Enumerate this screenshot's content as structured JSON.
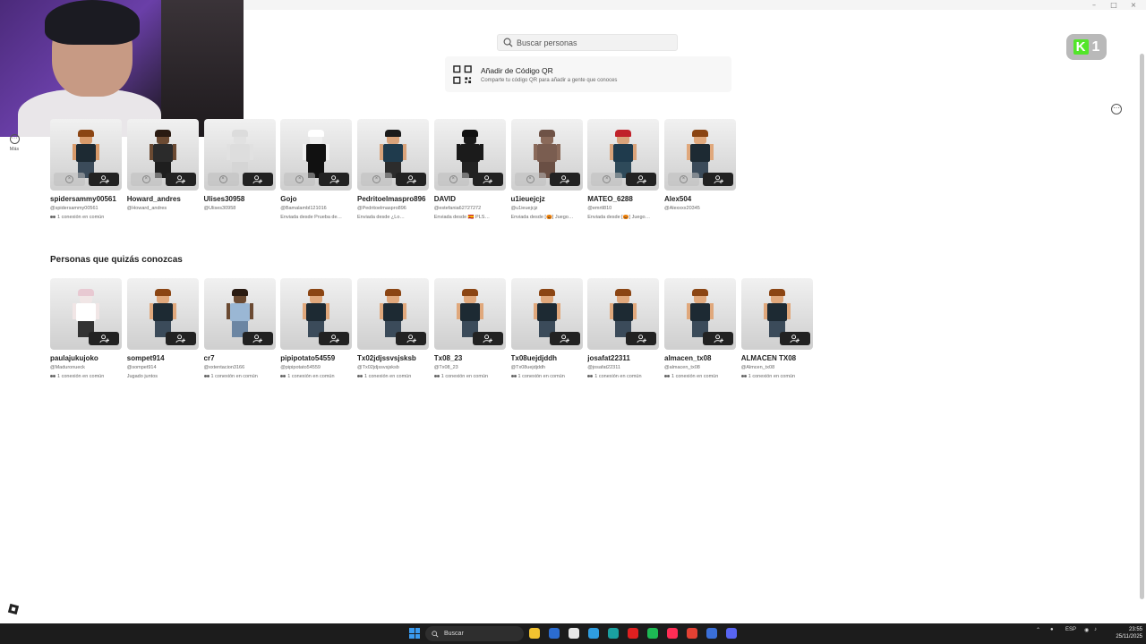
{
  "search": {
    "placeholder": "Buscar personas"
  },
  "qr": {
    "title": "Añadir de Código QR",
    "subtitle": "Comparte tu código QR para añadir a gente que conoces"
  },
  "brand_badge": {
    "letter": "K",
    "count": "1"
  },
  "left_nav": {
    "more_label": "Más"
  },
  "sections": {
    "requests": [
      {
        "name": "spidersammy00561",
        "handle": "@spidersammy00561",
        "meta": "1 conexión en común",
        "meta_icon": "people-icon",
        "skin": "#d89a6a",
        "hair": "#8b4513",
        "torso": "#1d2a33",
        "legs": "#3b4b5a"
      },
      {
        "name": "Howard_andres",
        "handle": "@Howard_andres",
        "meta": "",
        "meta_icon": "",
        "skin": "#6b4a32",
        "hair": "#2a1b12",
        "torso": "#2b2b2b",
        "legs": "#1e1e1e"
      },
      {
        "name": "Ulises30958",
        "handle": "@Ulises30958",
        "meta": "",
        "meta_icon": "",
        "skin": "#e1e1e1",
        "hair": "#dcdcdc",
        "torso": "#dddddd",
        "legs": "#d5d5d5"
      },
      {
        "name": "Gojo",
        "handle": "@Bamalambl121016",
        "meta": "Enviada desde Prueba de…",
        "meta_icon": "",
        "skin": "#f0f0f0",
        "hair": "#ffffff",
        "torso": "#111111",
        "legs": "#111111"
      },
      {
        "name": "Pedritoelmaspro896",
        "handle": "@Pedritoelmaspro896",
        "meta": "Enviada desde ¿Lo…",
        "meta_icon": "",
        "skin": "#d9a37a",
        "hair": "#1b1b1b",
        "torso": "#1f3b4d",
        "legs": "#2c2c2c"
      },
      {
        "name": "DAVID",
        "handle": "@estefania62727272",
        "meta": "Enviada desde 🇪🇸 PLS…",
        "meta_icon": "",
        "skin": "#1a1a1a",
        "hair": "#111111",
        "torso": "#1b1b1b",
        "legs": "#222222"
      },
      {
        "name": "u1ieuejcjz",
        "handle": "@u1ieuejcjz",
        "meta": "Enviada desde [🎃] Juego…",
        "meta_icon": "",
        "skin": "#8a6a5a",
        "hair": "#6e5246",
        "torso": "#7a5d50",
        "legs": "#6a4f44"
      },
      {
        "name": "MATEO_6288",
        "handle": "@emrtl810",
        "meta": "Enviada desde [🎃] Juego…",
        "meta_icon": "",
        "skin": "#d9a37a",
        "hair": "#c0222a",
        "torso": "#1f3b4d",
        "legs": "#2e4a5a"
      },
      {
        "name": "Alex504",
        "handle": "@Alexxxx20345",
        "meta": "",
        "meta_icon": "",
        "skin": "#e0a87c",
        "hair": "#8b4513",
        "torso": "#1d2a33",
        "legs": "#3b4b5a"
      }
    ],
    "suggestions_title": "Personas que quizás conozcas",
    "suggestions": [
      {
        "name": "paulajukujoko",
        "handle": "@Maduronueck",
        "meta": "1 conexión en común",
        "meta_icon": "people-icon",
        "skin": "#f1e6e6",
        "hair": "#e8c9d2",
        "torso": "#ffffff",
        "legs": "#333333"
      },
      {
        "name": "sompet914",
        "handle": "@sompet914",
        "meta": "Jugado juntos",
        "meta_icon": "",
        "skin": "#e0a87c",
        "hair": "#8b4513",
        "torso": "#1d2a33",
        "legs": "#3b4b5a"
      },
      {
        "name": "cr7",
        "handle": "@xxtentacion3166",
        "meta": "1 conexión en común",
        "meta_icon": "people-icon",
        "skin": "#6b4a32",
        "hair": "#2a1b12",
        "torso": "#9ab7d4",
        "legs": "#6c86a3"
      },
      {
        "name": "pipipotato54559",
        "handle": "@pipipotato54559",
        "meta": "1 conexión en común",
        "meta_icon": "people-icon",
        "skin": "#e0a87c",
        "hair": "#8b4513",
        "torso": "#1d2a33",
        "legs": "#3b4b5a"
      },
      {
        "name": "Tx02jdjssvsjsksb",
        "handle": "@Tx02jdjssvsjsksb",
        "meta": "1 conexión en común",
        "meta_icon": "people-icon",
        "skin": "#e0a87c",
        "hair": "#8b4513",
        "torso": "#1d2a33",
        "legs": "#3b4b5a"
      },
      {
        "name": "Tx08_23",
        "handle": "@Tx08_23",
        "meta": "1 conexión en común",
        "meta_icon": "people-icon",
        "skin": "#e0a87c",
        "hair": "#8b4513",
        "torso": "#1d2a33",
        "legs": "#3b4b5a"
      },
      {
        "name": "Tx08uejdjddh",
        "handle": "@Tx08uejdjddh",
        "meta": "1 conexión en común",
        "meta_icon": "people-icon",
        "skin": "#e0a87c",
        "hair": "#8b4513",
        "torso": "#1d2a33",
        "legs": "#3b4b5a"
      },
      {
        "name": "josafat22311",
        "handle": "@josafat22311",
        "meta": "1 conexión en común",
        "meta_icon": "people-icon",
        "skin": "#e0a87c",
        "hair": "#8b4513",
        "torso": "#1d2a33",
        "legs": "#3b4b5a"
      },
      {
        "name": "almacen_tx08",
        "handle": "@almacen_tx08",
        "meta": "1 conexión en común",
        "meta_icon": "people-icon",
        "skin": "#e0a87c",
        "hair": "#8b4513",
        "torso": "#1d2a33",
        "legs": "#3b4b5a"
      },
      {
        "name": "ALMACEN TX08",
        "handle": "@Almcen_tx08",
        "meta": "1 conexión en común",
        "meta_icon": "people-icon",
        "skin": "#e0a87c",
        "hair": "#8b4513",
        "torso": "#1d2a33",
        "legs": "#3b4b5a"
      }
    ]
  },
  "taskbar": {
    "search_label": "Buscar",
    "language": "ESP",
    "time": "23:55",
    "date": "25/11/2025",
    "apps": [
      {
        "icon": "file-explorer-icon",
        "color": "#f2c230"
      },
      {
        "icon": "notes-icon",
        "color": "#2b6cd0"
      },
      {
        "icon": "store-icon",
        "color": "#e8e8e8"
      },
      {
        "icon": "edge-icon",
        "color": "#2f9de0"
      },
      {
        "icon": "edge-browser-icon",
        "color": "#1aa0a0"
      },
      {
        "icon": "youtube-icon",
        "color": "#e02020"
      },
      {
        "icon": "spotify-icon",
        "color": "#1db954"
      },
      {
        "icon": "tiktok-icon",
        "color": "#ff2d55"
      },
      {
        "icon": "chrome-icon",
        "color": "#e34133"
      },
      {
        "icon": "roblox-studio-icon",
        "color": "#3a6fd8"
      },
      {
        "icon": "discord-icon",
        "color": "#5865f2"
      }
    ]
  },
  "colors": {
    "accent_green": "#53e62a",
    "button_dark": "#222222"
  }
}
